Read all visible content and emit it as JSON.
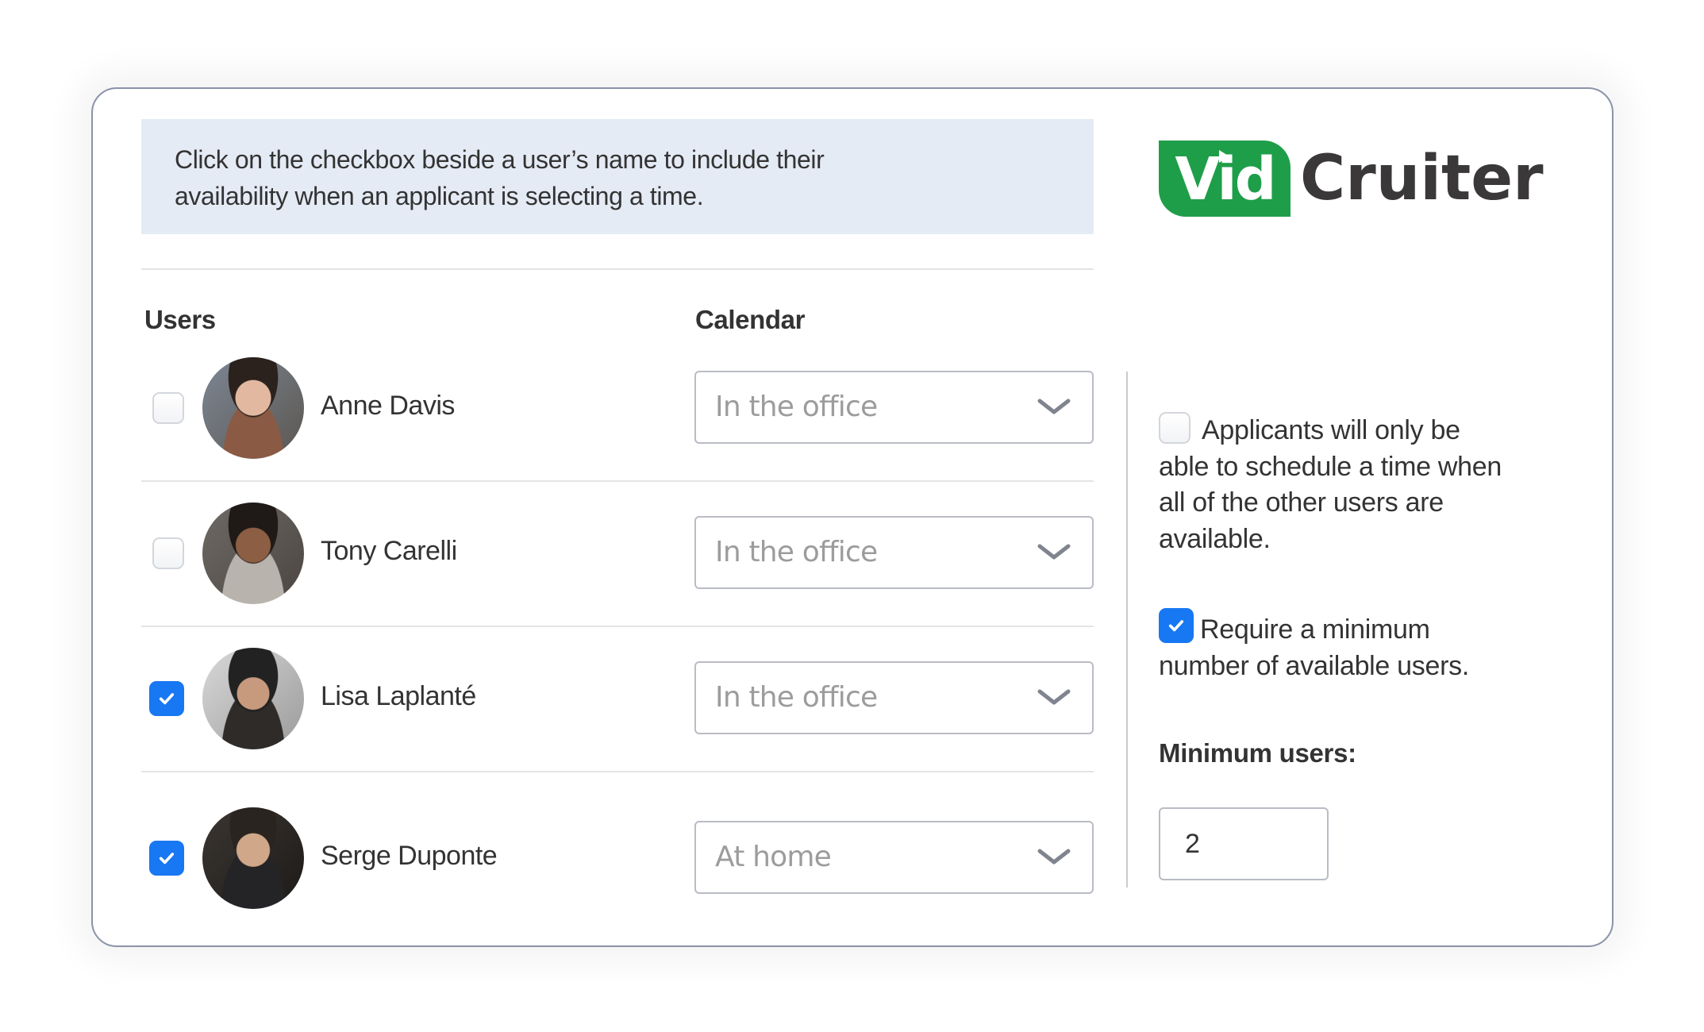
{
  "banner": {
    "text_line1": "Click on the checkbox beside a user’s name to include their",
    "text_line2": "availability when an applicant is selecting a time."
  },
  "logo": {
    "vid": "Vid",
    "cruiter": "Cruiter",
    "brand_green": "#1f9e4a",
    "brand_dark": "#3a3838"
  },
  "columns": {
    "users": "Users",
    "calendar": "Calendar"
  },
  "users": [
    {
      "name": "Anne Davis",
      "checked": false,
      "calendar": "In the office",
      "avatar": "avatar-anne-davis"
    },
    {
      "name": "Tony Carelli",
      "checked": false,
      "calendar": "In the office",
      "avatar": "avatar-tony-carelli"
    },
    {
      "name": "Lisa Laplanté",
      "checked": true,
      "calendar": "In the office",
      "avatar": "avatar-lisa-laplante"
    },
    {
      "name": "Serge Duponte",
      "checked": true,
      "calendar": "At home",
      "avatar": "avatar-serge-duponte"
    }
  ],
  "options": {
    "all_available": {
      "checked": false,
      "line1": "Applicants will only be",
      "line2": "able to schedule a time when",
      "line3": "all of the other users are",
      "line4": "available."
    },
    "require_minimum": {
      "checked": true,
      "line1": "Require a minimum",
      "line2": "number of available users."
    },
    "minimum_users_label": "Minimum users:",
    "minimum_users_value": "2"
  },
  "colors": {
    "checkbox_checked": "#1877f2",
    "banner_bg": "#e5ebf5",
    "card_border": "#8a93a8"
  },
  "icons": {
    "chevron": "chevron-down-icon",
    "check": "check-icon",
    "play": "play-triangle-icon"
  }
}
